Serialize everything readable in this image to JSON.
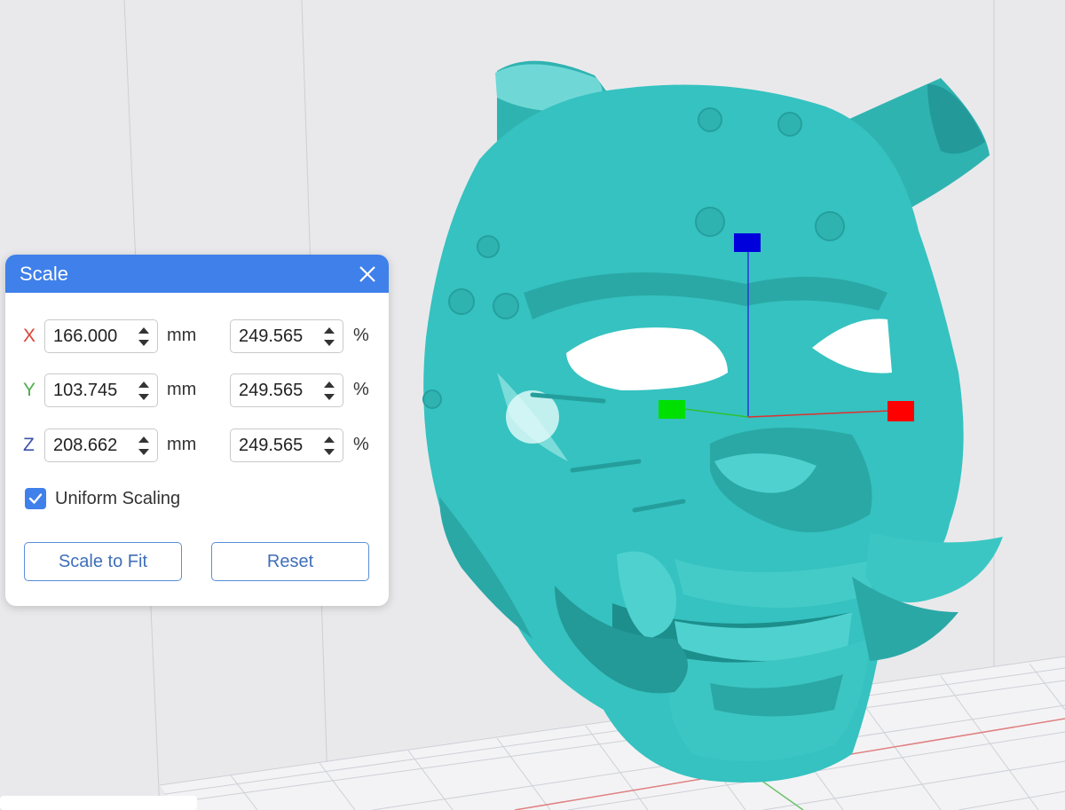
{
  "dialog": {
    "title": "Scale",
    "axes": [
      {
        "axis": "X",
        "color": "#d9463b",
        "mm": "166.000",
        "unit_mm": "mm",
        "percent": "249.565",
        "unit_pct": "%"
      },
      {
        "axis": "Y",
        "color": "#4caf50",
        "mm": "103.745",
        "unit_mm": "mm",
        "percent": "249.565",
        "unit_pct": "%"
      },
      {
        "axis": "Z",
        "color": "#3b53a8",
        "mm": "208.662",
        "unit_mm": "mm",
        "percent": "249.565",
        "unit_pct": "%"
      }
    ],
    "uniform_scaling": {
      "label": "Uniform Scaling",
      "checked": true
    },
    "scale_to_fit_label": "Scale to Fit",
    "reset_label": "Reset"
  },
  "viewport": {
    "model_color": "#35c2c0",
    "background_color": "#e9e9eb",
    "gizmo": {
      "x_color": "#ff0000",
      "y_color": "#00e000",
      "z_color": "#0000dd"
    }
  }
}
